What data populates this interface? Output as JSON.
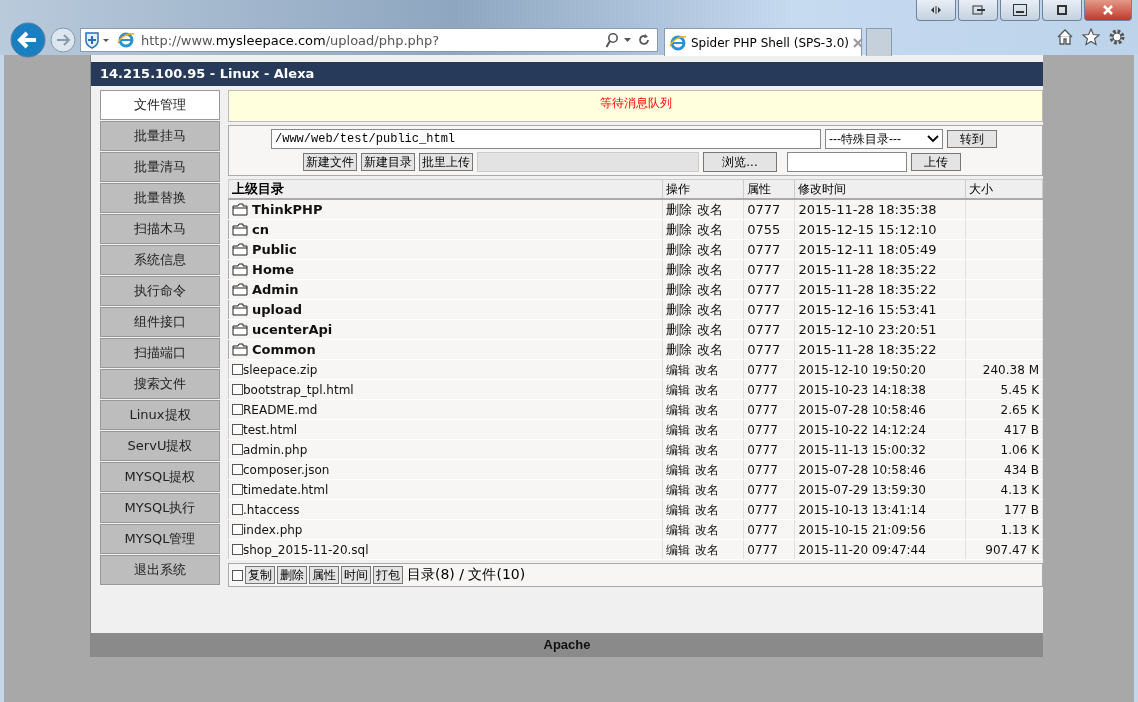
{
  "browser": {
    "url": "http://www.**mysleepace.com**/upload/php.php?",
    "tab_title": "Spider PHP Shell (SPS-3.0)"
  },
  "header": "14.215.100.95 - Linux - Alexa",
  "menu": [
    {
      "label": "文件管理",
      "selected": true
    },
    {
      "label": "批量挂马",
      "selected": false
    },
    {
      "label": "批量清马",
      "selected": false
    },
    {
      "label": "批量替换",
      "selected": false
    },
    {
      "label": "扫描木马",
      "selected": false
    },
    {
      "label": "系统信息",
      "selected": false
    },
    {
      "label": "执行命令",
      "selected": false
    },
    {
      "label": "组件接口",
      "selected": false
    },
    {
      "label": "扫描端口",
      "selected": false
    },
    {
      "label": "搜索文件",
      "selected": false
    },
    {
      "label": "Linux提权",
      "selected": false
    },
    {
      "label": "ServU提权",
      "selected": false
    },
    {
      "label": "MYSQL提权",
      "selected": false
    },
    {
      "label": "MYSQL执行",
      "selected": false
    },
    {
      "label": "MYSQL管理",
      "selected": false
    },
    {
      "label": "退出系统",
      "selected": false
    }
  ],
  "message": "等待消息队列",
  "toolbar": {
    "path": "/www/web/test/public_html",
    "special_dir": "---特殊目录---",
    "go_button": "转到",
    "new_file_button": "新建文件",
    "new_dir_button": "新建目录",
    "batch_upload_button": "批里上传",
    "browse_button": "浏览...",
    "upload_button": "上传"
  },
  "table": {
    "columns": [
      "上级目录",
      "操作",
      "属性",
      "修改时间",
      "大小"
    ],
    "rows": [
      {
        "kind": "folder",
        "name": "ThinkPHP",
        "actions": [
          "删除",
          "改名"
        ],
        "perm": "0777",
        "modified": "2015-11-28 18:35:38"
      },
      {
        "kind": "folder",
        "name": "cn",
        "actions": [
          "删除",
          "改名"
        ],
        "perm": "0755",
        "modified": "2015-12-15 15:12:10"
      },
      {
        "kind": "folder",
        "name": "Public",
        "actions": [
          "删除",
          "改名"
        ],
        "perm": "0777",
        "modified": "2015-12-11 18:05:49"
      },
      {
        "kind": "folder",
        "name": "Home",
        "actions": [
          "删除",
          "改名"
        ],
        "perm": "0777",
        "modified": "2015-11-28 18:35:22"
      },
      {
        "kind": "folder",
        "name": "Admin",
        "actions": [
          "删除",
          "改名"
        ],
        "perm": "0777",
        "modified": "2015-11-28 18:35:22"
      },
      {
        "kind": "folder",
        "name": "upload",
        "actions": [
          "删除",
          "改名"
        ],
        "perm": "0777",
        "modified": "2015-12-16 15:53:41"
      },
      {
        "kind": "folder",
        "name": "ucenterApi",
        "actions": [
          "删除",
          "改名"
        ],
        "perm": "0777",
        "modified": "2015-12-10 23:20:51"
      },
      {
        "kind": "folder",
        "name": "Common",
        "actions": [
          "删除",
          "改名"
        ],
        "perm": "0777",
        "modified": "2015-11-28 18:35:22"
      },
      {
        "kind": "file",
        "checked": false,
        "name": "sleepace.zip",
        "actions": [
          "编辑",
          "改名"
        ],
        "perm": "0777",
        "modified": "2015-12-10 19:50:20",
        "size": "240.38 M"
      },
      {
        "kind": "file",
        "checked": false,
        "name": "bootstrap_tpl.html",
        "actions": [
          "编辑",
          "改名"
        ],
        "perm": "0777",
        "modified": "2015-10-23 14:18:38",
        "size": "5.45 K"
      },
      {
        "kind": "file",
        "checked": false,
        "name": "README.md",
        "actions": [
          "编辑",
          "改名"
        ],
        "perm": "0777",
        "modified": "2015-07-28 10:58:46",
        "size": "2.65 K"
      },
      {
        "kind": "file",
        "checked": false,
        "name": "test.html",
        "actions": [
          "编辑",
          "改名"
        ],
        "perm": "0777",
        "modified": "2015-10-22 14:12:24",
        "size": "417 B"
      },
      {
        "kind": "file",
        "checked": false,
        "name": "admin.php",
        "actions": [
          "编辑",
          "改名"
        ],
        "perm": "0777",
        "modified": "2015-11-13 15:00:32",
        "size": "1.06 K"
      },
      {
        "kind": "file",
        "checked": false,
        "name": "composer.json",
        "actions": [
          "编辑",
          "改名"
        ],
        "perm": "0777",
        "modified": "2015-07-28 10:58:46",
        "size": "434 B"
      },
      {
        "kind": "file",
        "checked": false,
        "name": "timedate.html",
        "actions": [
          "编辑",
          "改名"
        ],
        "perm": "0777",
        "modified": "2015-07-29 13:59:30",
        "size": "4.13 K"
      },
      {
        "kind": "file",
        "checked": false,
        "name": ".htaccess",
        "actions": [
          "编辑",
          "改名"
        ],
        "perm": "0777",
        "modified": "2015-10-13 13:41:14",
        "size": "177 B"
      },
      {
        "kind": "file",
        "checked": false,
        "name": "index.php",
        "actions": [
          "编辑",
          "改名"
        ],
        "perm": "0777",
        "modified": "2015-10-15 21:09:56",
        "size": "1.13 K"
      },
      {
        "kind": "file",
        "checked": false,
        "name": "shop_2015-11-20.sql",
        "actions": [
          "编辑",
          "改名"
        ],
        "perm": "0777",
        "modified": "2015-11-20 09:47:44",
        "size": "907.47 K"
      }
    ]
  },
  "footer_actions": {
    "select_all_checked": false,
    "buttons": [
      "复制",
      "删除",
      "属性",
      "时间",
      "打包"
    ],
    "summary": "目录(8) / 文件(10)"
  },
  "server": "Apache"
}
